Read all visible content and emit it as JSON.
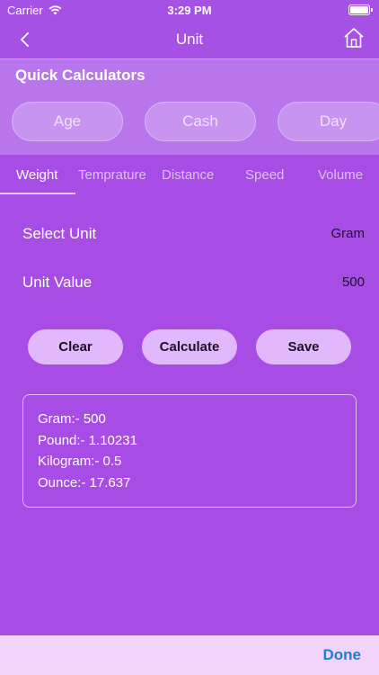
{
  "status_bar": {
    "carrier": "Carrier",
    "time": "3:29 PM"
  },
  "nav": {
    "title": "Unit",
    "back_icon": "chevron-left-icon",
    "home_icon": "home-icon"
  },
  "quick": {
    "title": "Quick Calculators",
    "buttons": [
      "Age",
      "Cash",
      "Day"
    ]
  },
  "tabs": {
    "items": [
      "Weight",
      "Temprature",
      "Distance",
      "Speed",
      "Volume"
    ],
    "active": "Weight"
  },
  "form": {
    "select_unit_label": "Select Unit",
    "select_unit_value": "Gram",
    "unit_value_label": "Unit Value",
    "unit_value_value": "500"
  },
  "actions": {
    "clear": "Clear",
    "calculate": "Calculate",
    "save": "Save"
  },
  "results": [
    "Gram:- 500",
    "Pound:- 1.10231",
    "Kilogram:- 0.5",
    "Ounce:- 17.637"
  ],
  "toolbar": {
    "done": "Done"
  },
  "colors": {
    "background": "#a84ce6",
    "button": "#e1b8fb",
    "done": "#1f7ed6"
  }
}
